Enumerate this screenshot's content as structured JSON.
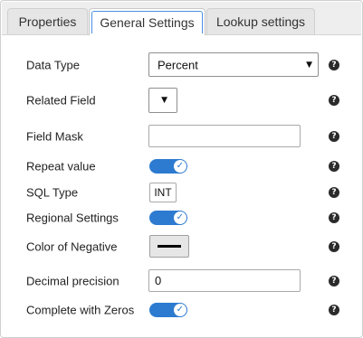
{
  "tabs": [
    {
      "label": "Properties",
      "active": false
    },
    {
      "label": "General Settings",
      "active": true
    },
    {
      "label": "Lookup settings",
      "active": false
    }
  ],
  "fields": {
    "data_type": {
      "label": "Data Type",
      "value": "Percent"
    },
    "related_field": {
      "label": "Related Field",
      "value": ""
    },
    "field_mask": {
      "label": "Field Mask",
      "value": ""
    },
    "repeat_value": {
      "label": "Repeat value",
      "on": true
    },
    "sql_type": {
      "label": "SQL Type",
      "value": "INT"
    },
    "regional_settings": {
      "label": "Regional Settings",
      "on": true
    },
    "color_of_negative": {
      "label": "Color of Negative",
      "color": "#000000"
    },
    "decimal_precision": {
      "label": "Decimal precision",
      "value": "0"
    },
    "complete_with_zeros": {
      "label": "Complete with Zeros",
      "on": true
    }
  },
  "help_glyph": "?",
  "caret_glyph": "▼",
  "check_glyph": "✓",
  "colors": {
    "accent": "#2c7bd0",
    "tab_active_border": "#4a90e2"
  }
}
